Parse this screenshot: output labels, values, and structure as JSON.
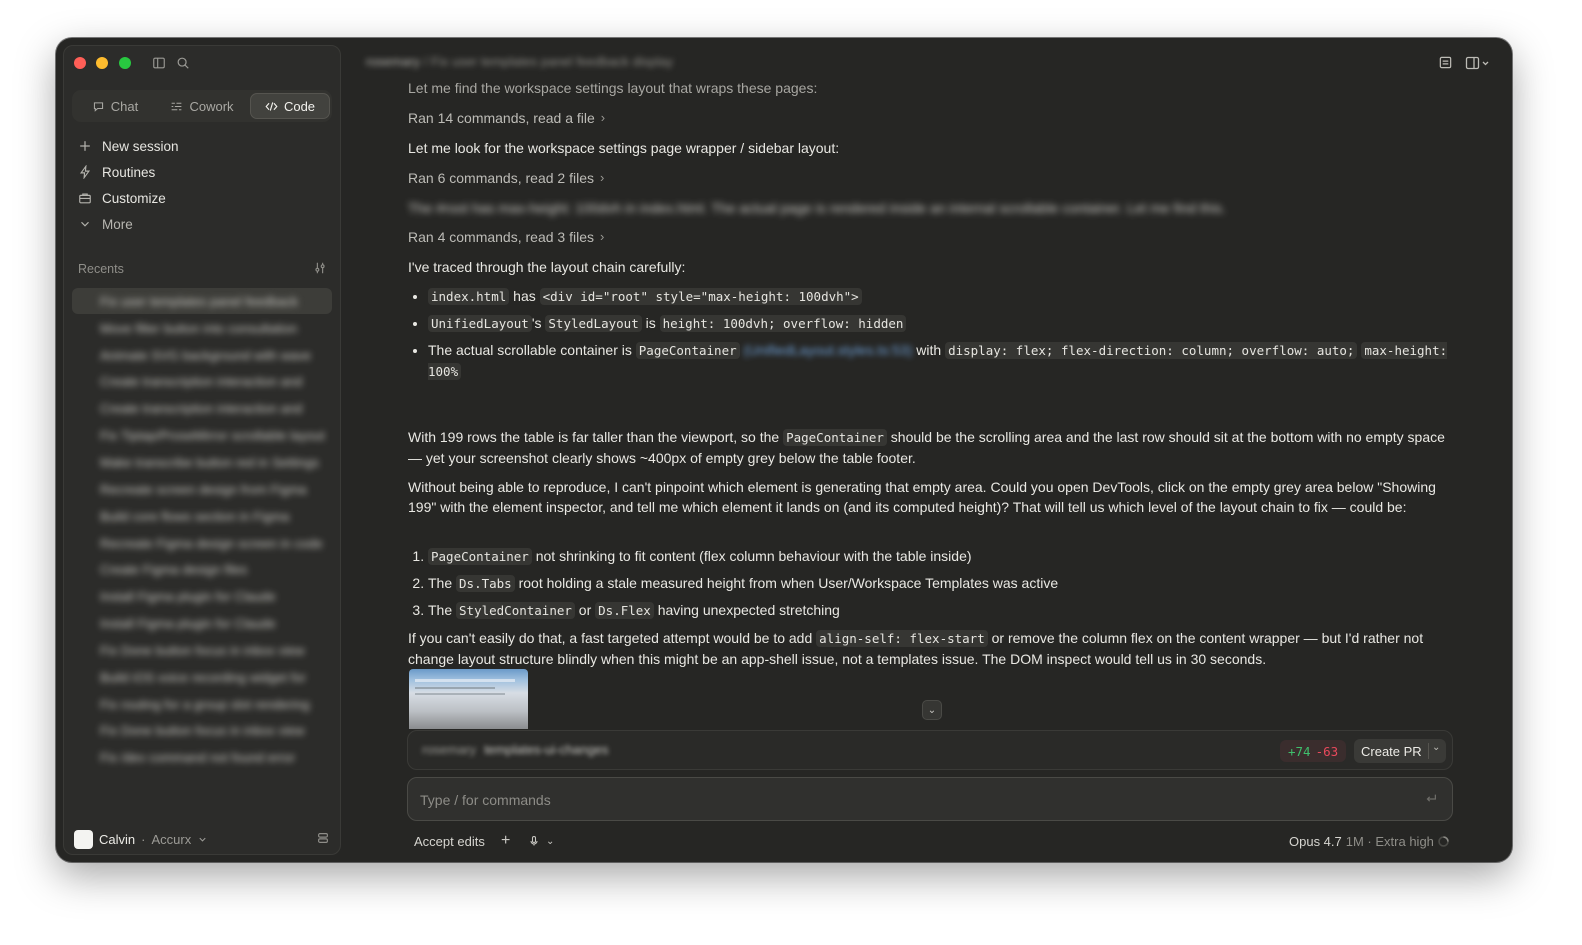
{
  "header": {
    "project": "rosemary",
    "session_title": "Fix user templates panel feedback display"
  },
  "sidebar": {
    "tabs": [
      {
        "label": "Chat",
        "icon": "chat-bubble-icon"
      },
      {
        "label": "Cowork",
        "icon": "cowork-icon"
      },
      {
        "label": "Code",
        "icon": "code-icon",
        "active": true
      }
    ],
    "nav": [
      {
        "label": "New session",
        "icon": "plus-icon"
      },
      {
        "label": "Routines",
        "icon": "bolt-icon"
      },
      {
        "label": "Customize",
        "icon": "briefcase-icon"
      },
      {
        "label": "More",
        "icon": "chevron-down-icon"
      }
    ],
    "recents_label": "Recents",
    "recents": [
      "Fix user templates panel feedback",
      "Move filter button into consultation",
      "Animate SVG background with wave",
      "Create transcription interaction and",
      "Create transcription interaction and",
      "Fix Tiptap/ProseMirror scrollable layout",
      "Make transcribe button red in Settings",
      "Recreate screen design from Figma",
      "Build core flows section in Figma",
      "Recreate Figma design screen in code",
      "Create Figma design files",
      "Install Figma plugin for Claude",
      "Install Figma plugin for Claude",
      "Fix Done button focus in inbox view",
      "Build iOS voice recording widget for",
      "Fix routing for a group slot rendering",
      "Fix Done button focus in inbox view",
      "Fix /dev command not found error"
    ],
    "user": {
      "name": "Calvin",
      "org": "Accurx"
    }
  },
  "conversation": {
    "intro": "Let me find the workspace settings layout that wraps these pages:",
    "ran1": "Ran 14 commands, read a file",
    "look": "Let me look for the workspace settings page wrapper / sidebar layout:",
    "ran2": "Ran 6 commands, read 2 files",
    "blurred": "The #root has max-height: 100dvh in index.html. The actual page is rendered inside an internal scrollable container. Let me find this.",
    "ran3": "Ran 4 commands, read 3 files",
    "traced": "I've traced through the layout chain carefully:",
    "b1": {
      "code1": "index.html",
      "t1": " has ",
      "code2": "<div id=\"root\" style=\"max-height: 100dvh\">"
    },
    "b2": {
      "code1": "UnifiedLayout",
      "t1": "'s ",
      "code2": "StyledLayout",
      "t2": " is ",
      "code3": "height: 100dvh; overflow: hidden"
    },
    "b3": {
      "t1": "The actual scrollable container is ",
      "code1": "PageContainer",
      "link": "(UnifiedLayout.styles.ts:53)",
      "t2": " with ",
      "code2": "display: flex; flex-direction: column; overflow: auto;",
      "code3": "max-height: 100%"
    },
    "p1": {
      "t1": "With 199 rows the table is far taller than the viewport, so the ",
      "code1": "PageContainer",
      "t2": " should be the scrolling area and the last row should sit at the bottom with no empty space — yet your screenshot clearly shows ~400px of empty grey below the table footer."
    },
    "p2": "Without being able to reproduce, I can't pinpoint which element is generating that empty area. Could you open DevTools, click on the empty grey area below \"Showing 199\" with the element inspector, and tell me which element it lands on (and its computed height)? That will tell us which level of the layout chain to fix — could be:",
    "n1": {
      "code1": "PageContainer",
      "t1": " not shrinking to fit content (flex column behaviour with the table inside)"
    },
    "n2": {
      "t0": "The ",
      "code1": "Ds.Tabs",
      "t1": " root holding a stale measured height from when User/Workspace Templates was active"
    },
    "n3": {
      "t0": "The ",
      "code1": "StyledContainer",
      "t1": " or ",
      "code2": "Ds.Flex",
      "t2": " having unexpected stretching"
    },
    "p3": {
      "t1": "If you can't easily do that, a fast targeted attempt would be to add ",
      "code1": "align-self: flex-start",
      "t2": " or remove the column flex on the content wrapper — but I'd rather not change layout structure blindly when this might be an app-shell issue, not a templates issue. The DOM inspect would tell us in 30 seconds."
    }
  },
  "branch": {
    "repo": "rosemary",
    "name": "templates-ui-changes",
    "additions": "+74",
    "deletions": "-63",
    "create_pr": "Create PR"
  },
  "composer": {
    "placeholder": "Type / for commands",
    "accept_edits": "Accept edits",
    "model": "Opus 4.7",
    "model_detail": "1M · Extra high"
  }
}
